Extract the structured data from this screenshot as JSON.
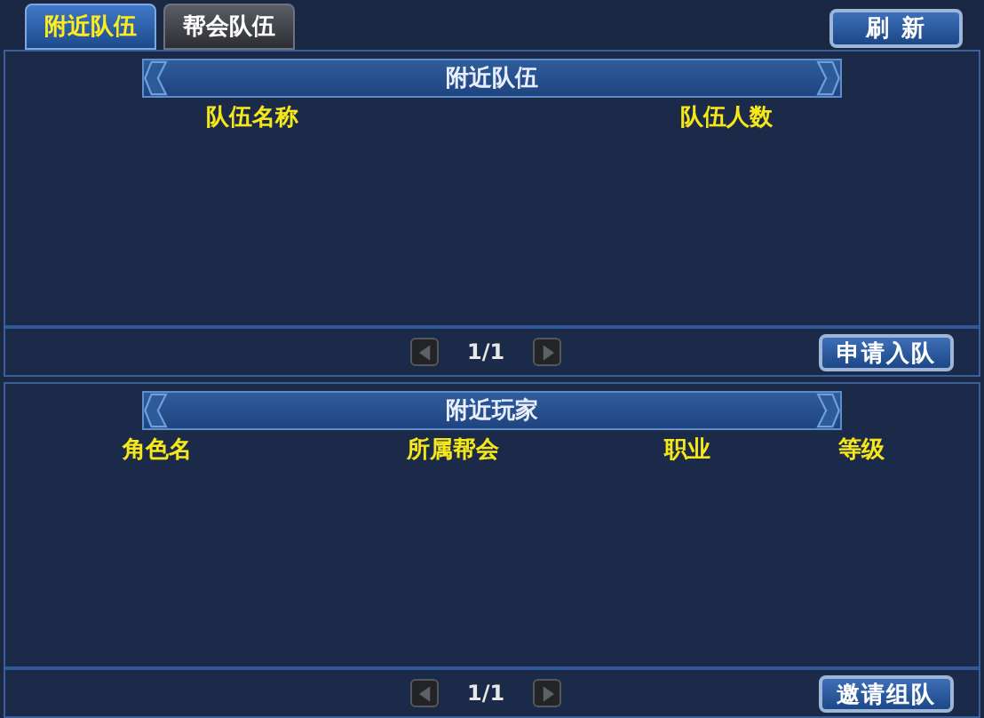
{
  "tabs": [
    {
      "label": "附近队伍",
      "selected": true
    },
    {
      "label": "帮会队伍",
      "selected": false
    }
  ],
  "refresh_button": "刷 新",
  "sections": [
    {
      "title": "附近队伍",
      "columns": [
        "队伍名称",
        "队伍人数"
      ],
      "page": "1/1",
      "action_button": "申请入队"
    },
    {
      "title": "附近玩家",
      "columns": [
        "角色名",
        "所属帮会",
        "职业",
        "等级"
      ],
      "page": "1/1",
      "action_button": "邀请组队"
    }
  ]
}
